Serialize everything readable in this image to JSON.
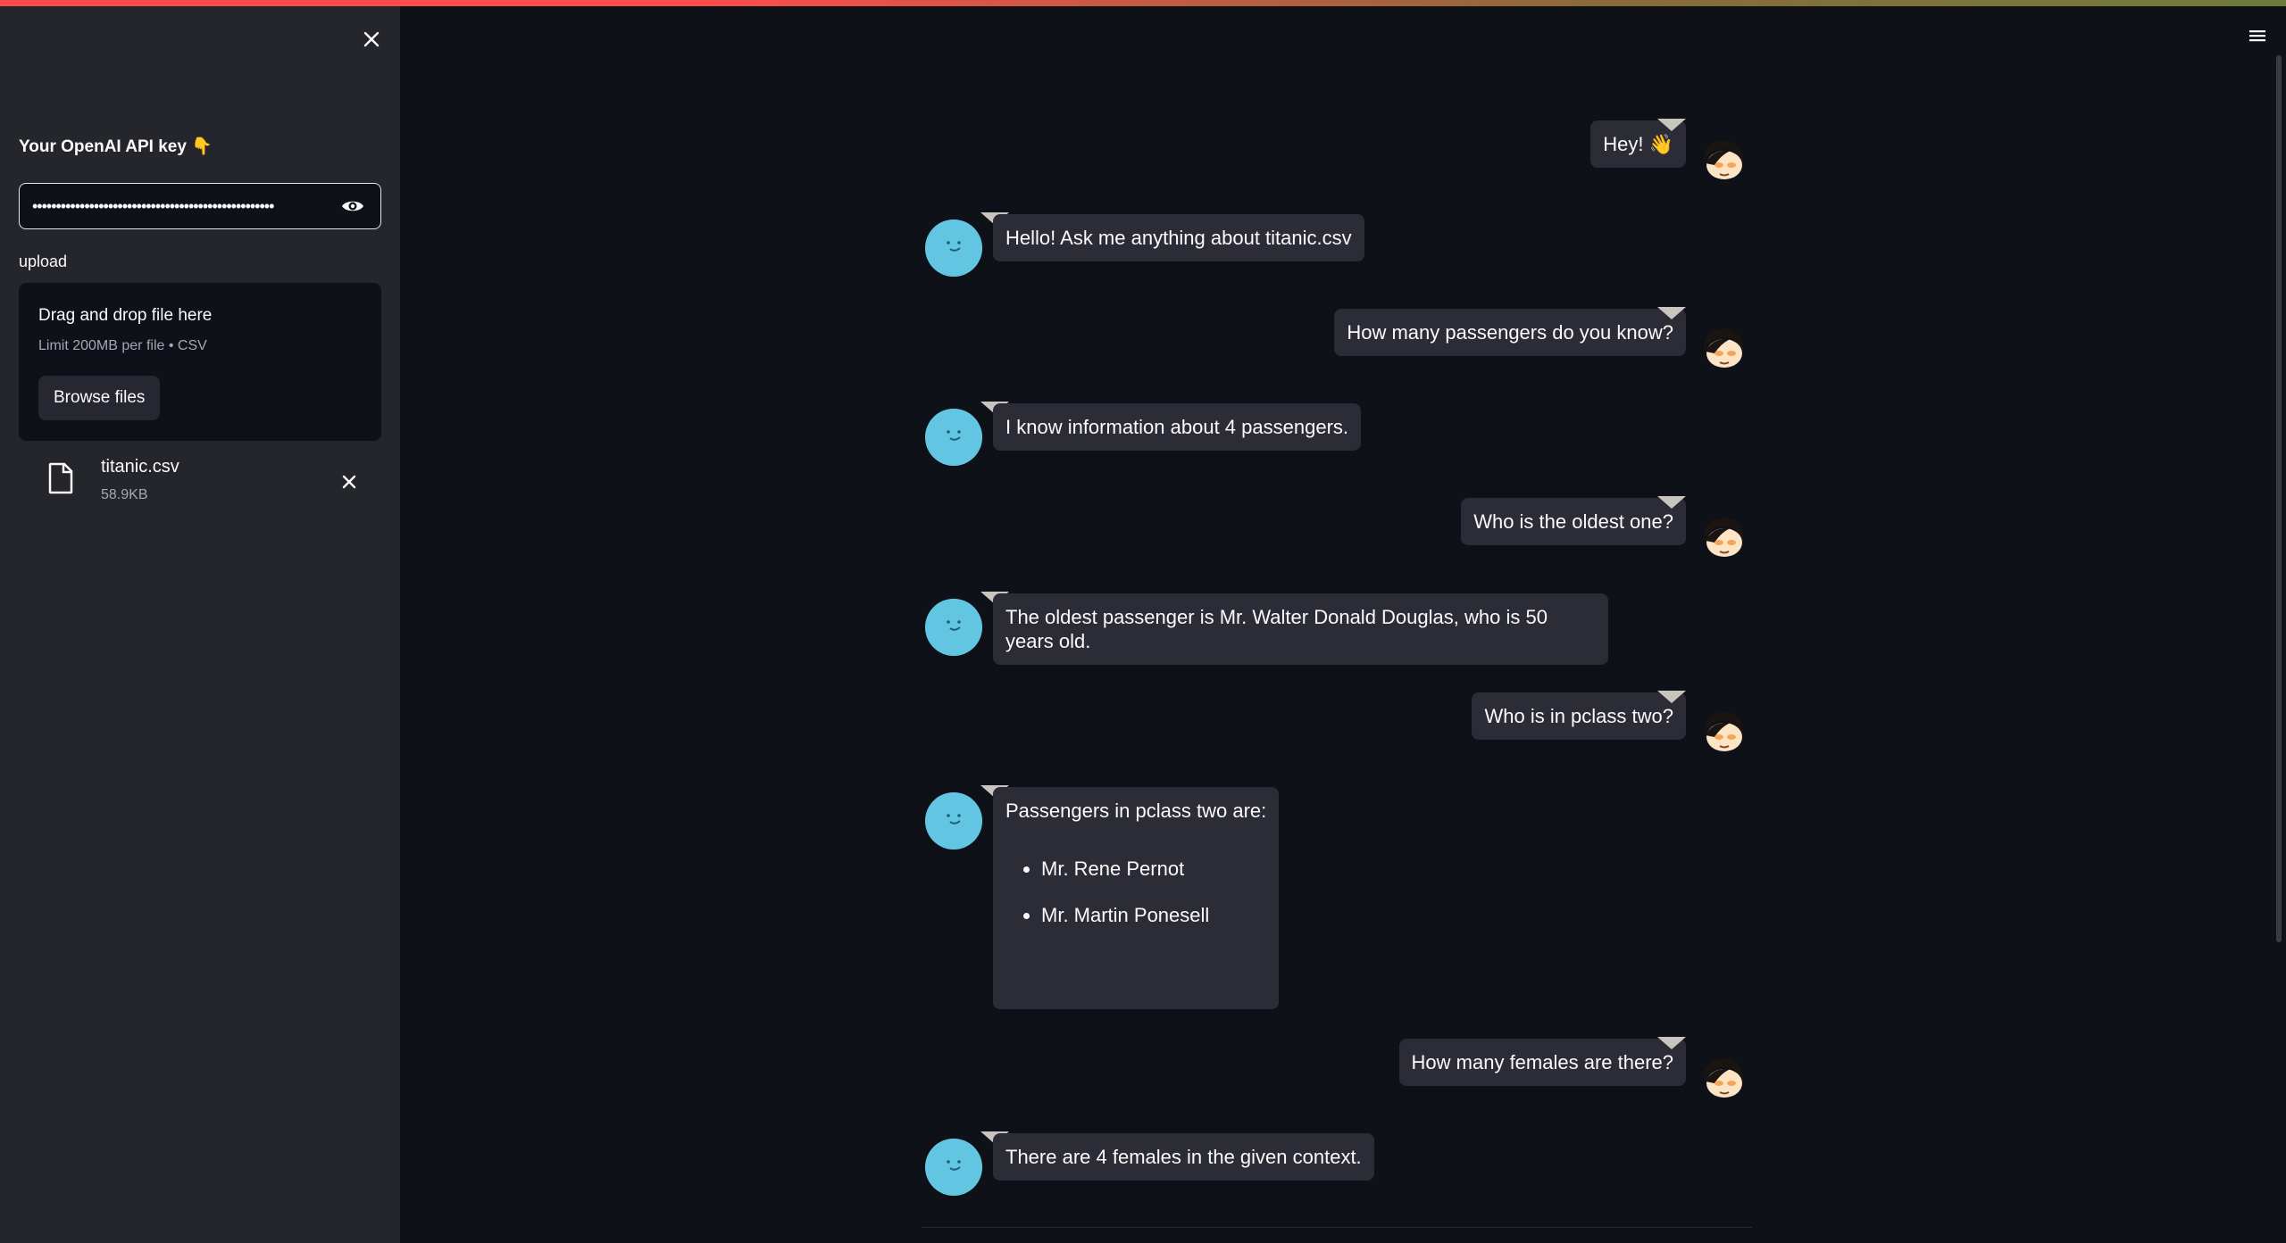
{
  "sidebar": {
    "api_key_label": "Your OpenAI API key 👇",
    "api_key_value": "•••••••••••••••••••••••••••••••••••••••••••••••••••",
    "upload_label": "upload",
    "dropzone": {
      "title": "Drag and drop file here",
      "limit": "Limit 200MB per file • CSV",
      "browse_label": "Browse files"
    },
    "file": {
      "name": "titanic.csv",
      "size": "58.9KB"
    }
  },
  "chat": {
    "messages": [
      {
        "role": "user",
        "text": "Hey! 👋"
      },
      {
        "role": "bot",
        "text": "Hello! Ask me anything about titanic.csv"
      },
      {
        "role": "user",
        "text": "How many passengers do you know?"
      },
      {
        "role": "bot",
        "text": "I know information about 4 passengers."
      },
      {
        "role": "user",
        "text": "Who is the oldest one?"
      },
      {
        "role": "bot",
        "text": "The oldest passenger is Mr. Walter Donald Douglas, who is 50 years old."
      },
      {
        "role": "user",
        "text": "Who is in pclass two?"
      },
      {
        "role": "bot",
        "text": "Passengers in pclass two are:",
        "list": [
          "Mr. Rene Pernot",
          "Mr. Martin Ponesell"
        ]
      },
      {
        "role": "user",
        "text": "How many females are there?"
      },
      {
        "role": "bot",
        "text": "There are 4 females in the given context."
      }
    ]
  },
  "colors": {
    "background": "#0e1117",
    "sidebar": "#24262b",
    "bubble": "#2b2c36",
    "bot_avatar": "#62c6e2",
    "accent": "#ff4b4b"
  }
}
